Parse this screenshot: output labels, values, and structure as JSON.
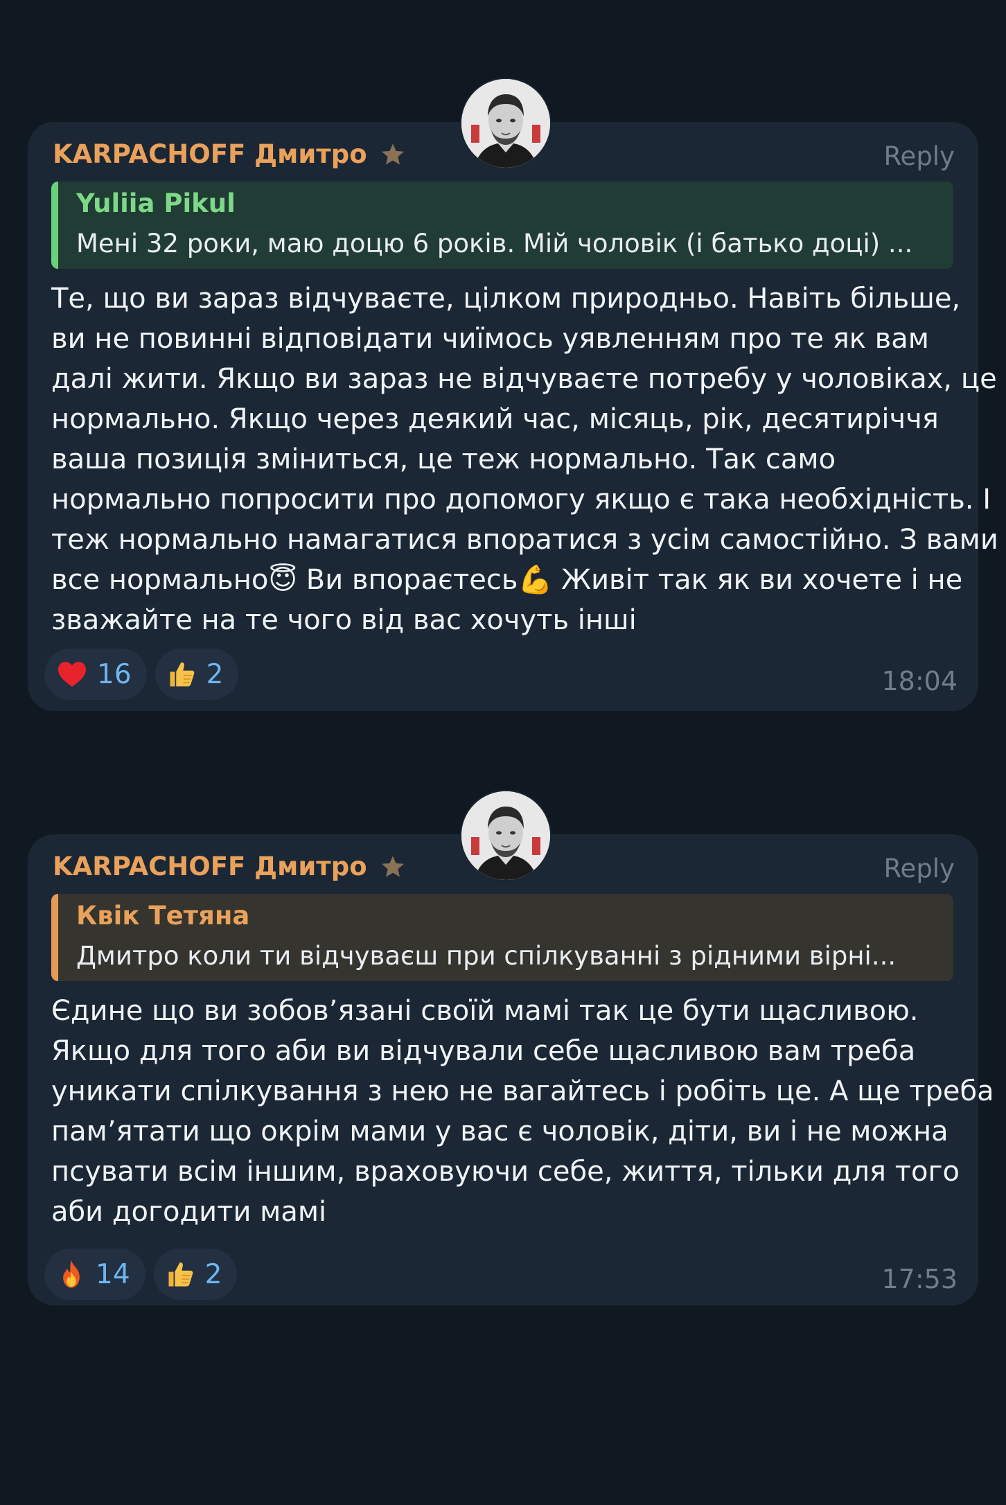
{
  "messages": [
    {
      "author": "KARPACHOFF Дмитро",
      "reply_label": "Reply",
      "quote": {
        "author": "Yuliia Pikul",
        "text": "Мені 32 роки, маю доцю 6 років. Мій чоловік (і батько доці) ..."
      },
      "body_lines": [
        "Те, що ви зараз відчуваєте, цілком природньо. Навіть більше,",
        "ви не повинні відповідати чиїмось уявленням про те як вам",
        "далі жити. Якщо ви зараз не відчуваєте потребу у чоловіках, це",
        "нормально. Якщо через деякий час, місяць, рік, десятиріччя",
        "ваша позиція зміниться, це теж нормально. Так само",
        "нормально попросити про допомогу якщо є така необхідність. І",
        "теж нормально намагатися впоратися з усім самостійно. З вами",
        "все нормально😇 Ви впораєтесь💪 Живіт так як ви хочете і не",
        "зважайте на те чого від вас хочуть інші"
      ],
      "reactions": [
        {
          "icon": "heart-icon",
          "count": "16"
        },
        {
          "icon": "thumbs-up-icon",
          "count": "2"
        }
      ],
      "time": "18:04"
    },
    {
      "author": "KARPACHOFF Дмитро",
      "reply_label": "Reply",
      "quote": {
        "author": "Квік Тетяна",
        "text": "Дмитро коли ти відчуваєш  при спілкуванні  з рідними вірні..."
      },
      "body_lines": [
        "Єдине що ви зобов’язані своїй мамі так це бути щасливою.",
        "Якщо для того аби ви відчували себе щасливою вам треба",
        "уникати спілкування з нею не вагайтесь і робіть це. А ще треба",
        "пам’ятати що окрім мами у вас є чоловік, діти, ви і не можна",
        "псувати всім іншим, враховуючи себе, життя, тільки для того",
        "аби догодити мамі"
      ],
      "reactions": [
        {
          "icon": "fire-icon",
          "count": "14"
        },
        {
          "icon": "thumbs-up-icon",
          "count": "2"
        }
      ],
      "time": "17:53"
    }
  ],
  "colors": {
    "background": "#101822",
    "bubble": "#1b2734",
    "author": "#e9a15b",
    "quote_green": "#69d37a",
    "quote_orange": "#e79a56",
    "reaction_count": "#6fb5f2",
    "time": "#6f7d8e"
  }
}
